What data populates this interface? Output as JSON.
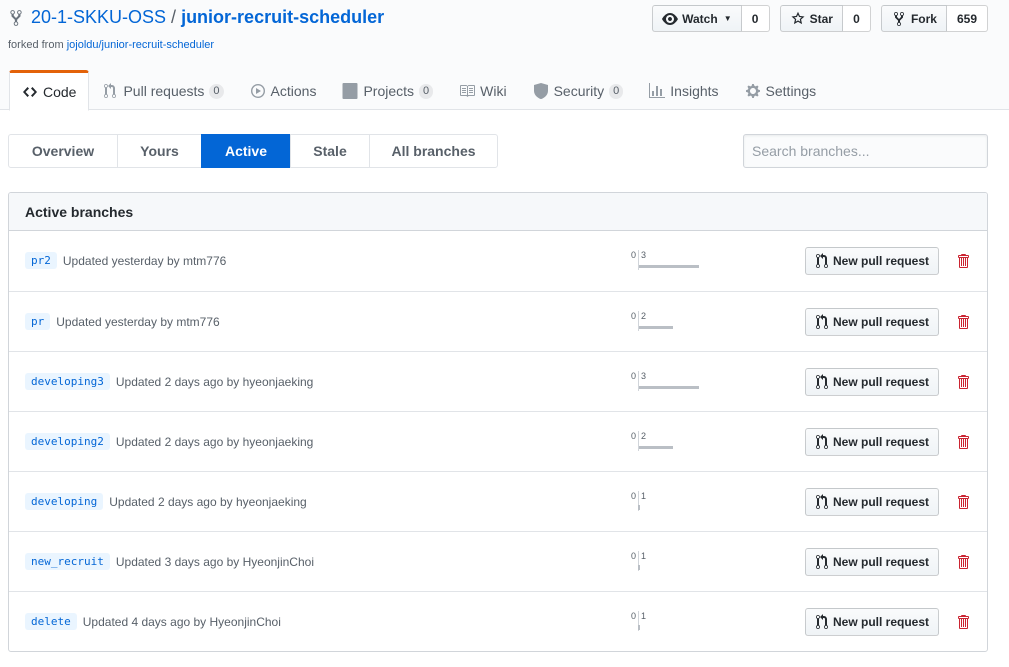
{
  "header": {
    "owner": "20-1-SKKU-OSS",
    "separator": "/",
    "repo": "junior-recruit-scheduler",
    "forked_prefix": "forked from",
    "forked_source": "jojoldu/junior-recruit-scheduler"
  },
  "actions": {
    "watch_label": "Watch",
    "watch_count": "0",
    "star_label": "Star",
    "star_count": "0",
    "fork_label": "Fork",
    "fork_count": "659"
  },
  "nav": {
    "code": "Code",
    "pulls": "Pull requests",
    "pulls_count": "0",
    "actions": "Actions",
    "projects": "Projects",
    "projects_count": "0",
    "wiki": "Wiki",
    "security": "Security",
    "security_count": "0",
    "insights": "Insights",
    "settings": "Settings"
  },
  "subnav": {
    "overview": "Overview",
    "yours": "Yours",
    "active": "Active",
    "stale": "Stale",
    "all": "All branches"
  },
  "search": {
    "placeholder": "Search branches..."
  },
  "box_title": "Active branches",
  "new_pr_label": "New pull request",
  "branches": [
    {
      "name": "pr2",
      "updated": "Updated yesterday by mtm776",
      "behind": 0,
      "ahead": 3
    },
    {
      "name": "pr",
      "updated": "Updated yesterday by mtm776",
      "behind": 0,
      "ahead": 2
    },
    {
      "name": "developing3",
      "updated": "Updated 2 days ago by hyeonjaeking",
      "behind": 0,
      "ahead": 3
    },
    {
      "name": "developing2",
      "updated": "Updated 2 days ago by hyeonjaeking",
      "behind": 0,
      "ahead": 2
    },
    {
      "name": "developing",
      "updated": "Updated 2 days ago by hyeonjaeking",
      "behind": 0,
      "ahead": 1
    },
    {
      "name": "new_recruit",
      "updated": "Updated 3 days ago by HyeonjinChoi",
      "behind": 0,
      "ahead": 1
    },
    {
      "name": "delete",
      "updated": "Updated 4 days ago by HyeonjinChoi",
      "behind": 0,
      "ahead": 1
    }
  ],
  "colors": {
    "accent": "#0366d6",
    "selected_tab_border": "#e36209",
    "delete": "#cb2431"
  }
}
